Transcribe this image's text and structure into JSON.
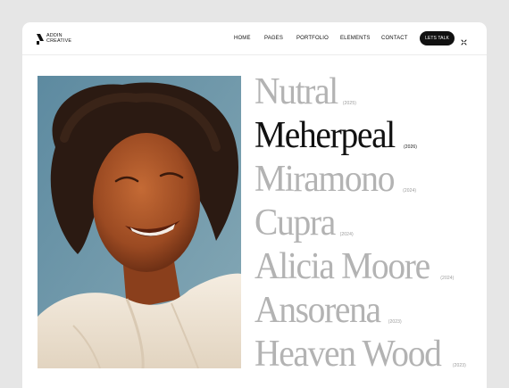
{
  "brand": {
    "name_line1": "ADDIN",
    "name_line2": "CREATIVE"
  },
  "nav": {
    "items": [
      {
        "label": "HOME"
      },
      {
        "label": "PAGES"
      },
      {
        "label": "PORTFOLIO"
      },
      {
        "label": "ELEMENTS"
      },
      {
        "label": "CONTACT"
      }
    ],
    "cta_label": "LETS TALK",
    "menu_icon": "grid-expand-icon"
  },
  "hero_image": {
    "subject": "smiling-woman-portrait",
    "colors": {
      "sky": "#6f96a8",
      "hair": "#2b1a12",
      "skin": "#a8552a",
      "blouse": "#f2e9dc"
    }
  },
  "projects": [
    {
      "name": "Nutral",
      "year": "(2025)",
      "active": false
    },
    {
      "name": "Meherpeal",
      "year": "(2026)",
      "active": true
    },
    {
      "name": "Miramono",
      "year": "(2024)",
      "active": false
    },
    {
      "name": "Cupra",
      "year": "(2024)",
      "active": false
    },
    {
      "name": "Alicia Moore",
      "year": "(2024)",
      "active": false
    },
    {
      "name": "Ansorena",
      "year": "(2023)",
      "active": false
    },
    {
      "name": "Heaven Wood",
      "year": "(2023)",
      "active": false
    }
  ],
  "colors": {
    "active": "#111111",
    "inactive": "#b3b3b3",
    "background": "#e6e6e6"
  }
}
